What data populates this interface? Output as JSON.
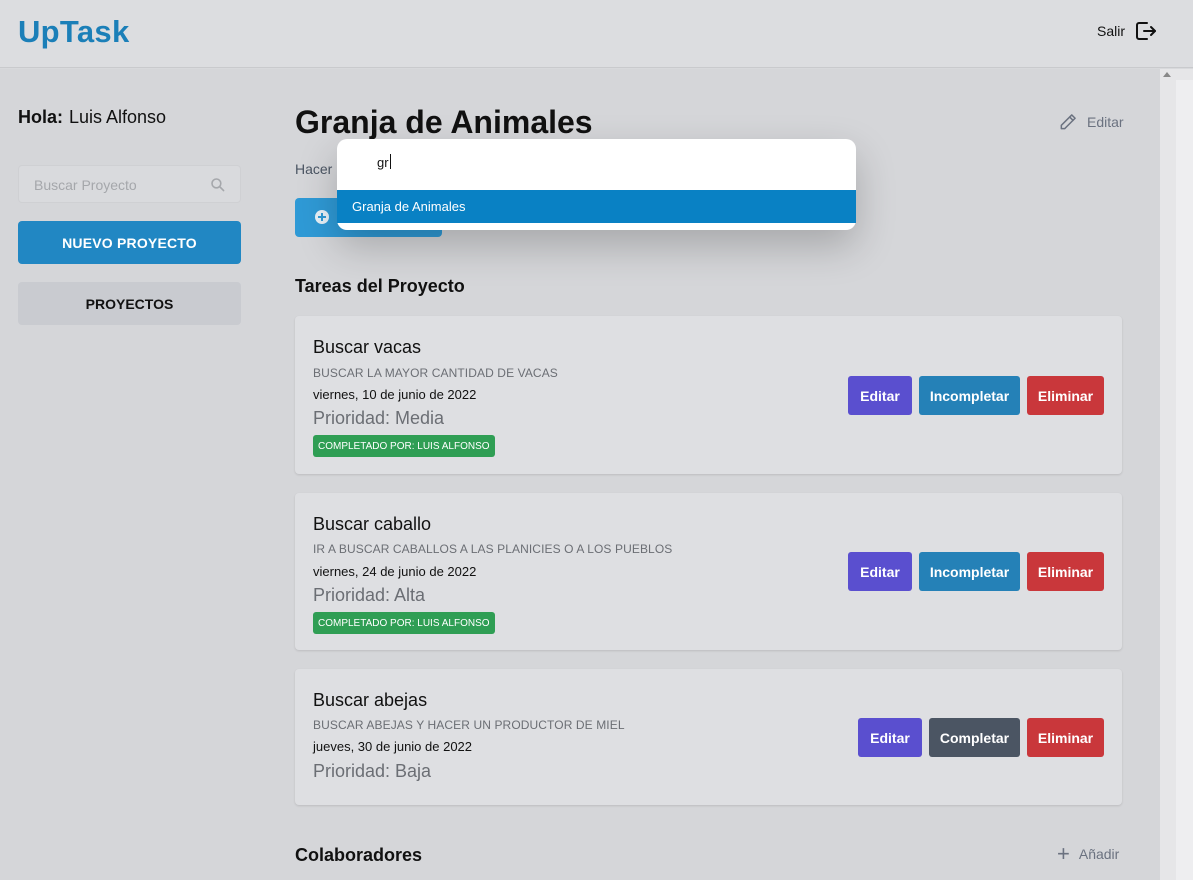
{
  "header": {
    "logo": "UpTask",
    "logout_label": "Salir"
  },
  "sidebar": {
    "greeting_prefix": "Hola:",
    "user_name": "Luis Alfonso",
    "search_placeholder": "Buscar Proyecto",
    "new_project_label": "NUEVO PROYECTO",
    "projects_label": "PROYECTOS"
  },
  "main": {
    "project_title": "Granja de Animales",
    "edit_label": "Editar",
    "new_task_prefix": "Hacer",
    "tasks_section_title": "Tareas del Proyecto",
    "collaborators_title": "Colaboradores",
    "add_label": "Añadir",
    "tasks": [
      {
        "name": "Buscar vacas",
        "description": "BUSCAR LA MAYOR CANTIDAD DE VACAS",
        "date": "viernes, 10 de junio de 2022",
        "priority": "Prioridad: Media",
        "badge": "COMPLETADO POR: LUIS ALFONSO",
        "edit_label": "Editar",
        "toggle_label": "Incompletar",
        "delete_label": "Eliminar"
      },
      {
        "name": "Buscar caballo",
        "description": "IR A BUSCAR CABALLOS A LAS PLANICIES O A LOS PUEBLOS",
        "date": "viernes, 24 de junio de 2022",
        "priority": "Prioridad: Alta",
        "badge": "COMPLETADO POR: LUIS ALFONSO",
        "edit_label": "Editar",
        "toggle_label": "Incompletar",
        "delete_label": "Eliminar"
      },
      {
        "name": "Buscar abejas",
        "description": "BUSCAR ABEJAS Y HACER UN PRODUCTOR DE MIEL",
        "date": "jueves, 30 de junio de 2022",
        "priority": "Prioridad: Baja",
        "edit_label": "Editar",
        "toggle_label": "Completar",
        "delete_label": "Eliminar"
      }
    ]
  },
  "search_palette": {
    "query": "gr",
    "results": [
      "Granja de Animales"
    ]
  },
  "colors": {
    "brand": "#1b7fb8",
    "primary_button": "#2187c3",
    "edit_button": "#5a4fcf",
    "toggle_button": "#2581b7",
    "complete_button": "#4b5563",
    "delete_button": "#c9373b",
    "badge": "#2f9e54",
    "palette_highlight": "#0981c4"
  }
}
